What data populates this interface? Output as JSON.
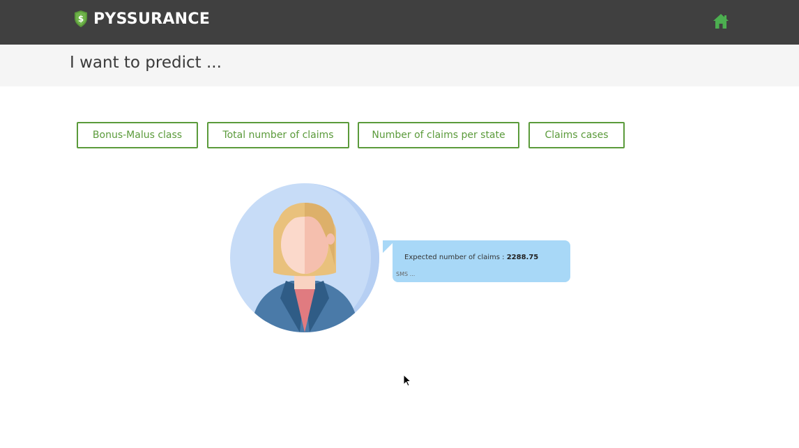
{
  "header": {
    "brand": "PYSSURANCE",
    "logo_icon": "shield-dollar-icon",
    "home_icon": "home-icon",
    "home_color": "#4caf50",
    "background": "#404040"
  },
  "subheader": {
    "title": "I want to predict ..."
  },
  "options": [
    {
      "label": "Bonus-Malus class"
    },
    {
      "label": "Total number of claims"
    },
    {
      "label": "Number of claims per state"
    },
    {
      "label": "Claims cases"
    }
  ],
  "accent_color": "#5a9a3a",
  "chat": {
    "message_prefix": "Expected number of claims : ",
    "message_value": "2288.75",
    "meta": "SMS ..."
  }
}
